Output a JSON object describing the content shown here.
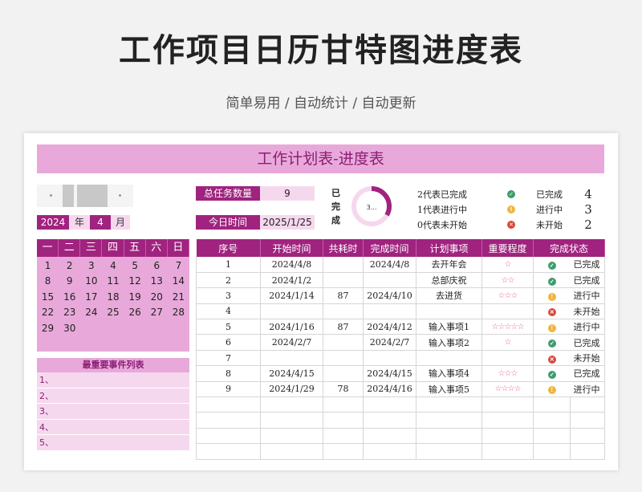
{
  "header": {
    "title": "工作项目日历甘特图进度表",
    "subtitle": "简单易用 / 自动统计 / 自动更新"
  },
  "sheet": {
    "title": "工作计划表-进度表",
    "year": "2024",
    "year_label": "年",
    "month": "4",
    "month_label": "月",
    "summary": {
      "total_label": "总任务数量",
      "total_value": "9",
      "today_label": "今日时间",
      "today_value": "2025/1/25"
    },
    "donut": {
      "label": "已完成",
      "value_text": "3...",
      "completed_fraction": 0.333
    },
    "legend": [
      {
        "desc": "2代表已完成",
        "icon": "check-icon",
        "name": "已完成",
        "count": "4"
      },
      {
        "desc": "1代表进行中",
        "icon": "exclamation-icon",
        "name": "进行中",
        "count": "3"
      },
      {
        "desc": "0代表未开始",
        "icon": "cross-icon",
        "name": "未开始",
        "count": "2"
      }
    ],
    "calendar": {
      "weekdays": [
        "一",
        "二",
        "三",
        "四",
        "五",
        "六",
        "日"
      ],
      "weeks": [
        [
          "1",
          "2",
          "3",
          "4",
          "5",
          "6",
          "7"
        ],
        [
          "8",
          "9",
          "10",
          "11",
          "12",
          "13",
          "14"
        ],
        [
          "15",
          "16",
          "17",
          "18",
          "19",
          "20",
          "21"
        ],
        [
          "22",
          "23",
          "24",
          "25",
          "26",
          "27",
          "28"
        ],
        [
          "29",
          "30",
          "",
          "",
          "",
          "",
          ""
        ]
      ]
    },
    "events": {
      "title": "最重要事件列表",
      "items": [
        "1、",
        "2、",
        "3、",
        "4、",
        "5、"
      ]
    },
    "table": {
      "headers": [
        "序号",
        "开始时间",
        "共耗时",
        "完成时间",
        "计划事项",
        "重要程度",
        "完成状态"
      ],
      "rows": [
        {
          "no": "1",
          "start": "2024/4/8",
          "days": "",
          "end": "2024/4/8",
          "item": "去开年会",
          "stars": "☆",
          "icon": "check-icon",
          "status": "已完成"
        },
        {
          "no": "2",
          "start": "2024/1/2",
          "days": "",
          "end": "",
          "item": "总部庆祝",
          "stars": "☆☆",
          "icon": "check-icon",
          "status": "已完成"
        },
        {
          "no": "3",
          "start": "2024/1/14",
          "days": "87",
          "end": "2024/4/10",
          "item": "去进货",
          "stars": "☆☆☆",
          "icon": "exclamation-icon",
          "status": "进行中"
        },
        {
          "no": "4",
          "start": "",
          "days": "",
          "end": "",
          "item": "",
          "stars": "",
          "icon": "cross-icon",
          "status": "未开始"
        },
        {
          "no": "5",
          "start": "2024/1/16",
          "days": "87",
          "end": "2024/4/12",
          "item": "输入事项1",
          "stars": "☆☆☆☆☆",
          "icon": "exclamation-icon",
          "status": "进行中"
        },
        {
          "no": "6",
          "start": "2024/2/7",
          "days": "",
          "end": "2024/2/7",
          "item": "输入事项2",
          "stars": "☆",
          "icon": "check-icon",
          "status": "已完成"
        },
        {
          "no": "7",
          "start": "",
          "days": "",
          "end": "",
          "item": "",
          "stars": "",
          "icon": "cross-icon",
          "status": "未开始"
        },
        {
          "no": "8",
          "start": "2024/4/15",
          "days": "",
          "end": "2024/4/15",
          "item": "输入事项4",
          "stars": "☆☆☆",
          "icon": "check-icon",
          "status": "已完成"
        },
        {
          "no": "9",
          "start": "2024/1/29",
          "days": "78",
          "end": "2024/4/16",
          "item": "输入事项5",
          "stars": "☆☆☆☆",
          "icon": "exclamation-icon",
          "status": "进行中"
        }
      ],
      "empty_rows": 4
    }
  }
}
